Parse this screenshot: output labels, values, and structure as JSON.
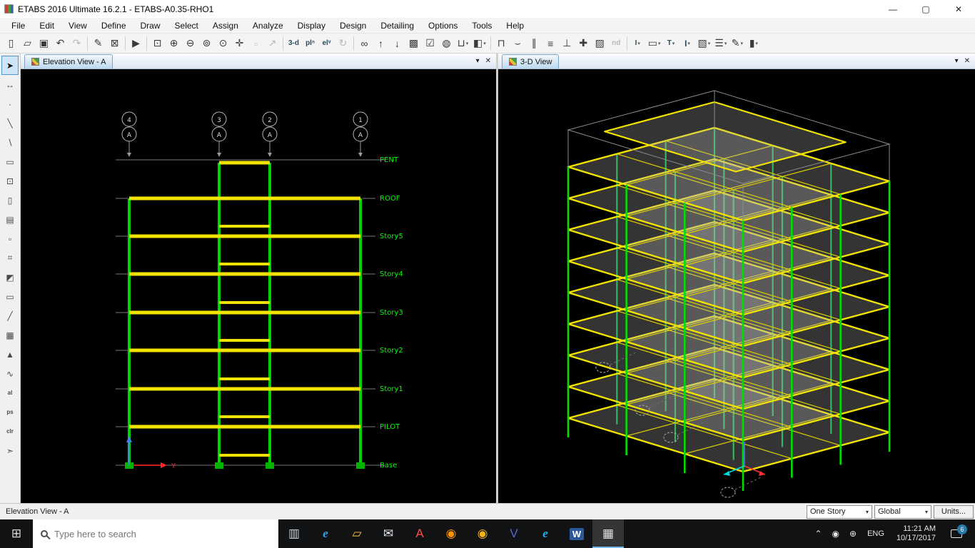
{
  "window": {
    "title": "ETABS 2016 Ultimate 16.2.1 - ETABS-A0.35-RHO1",
    "controls": {
      "minimize": "—",
      "maximize": "▢",
      "close": "✕"
    }
  },
  "menu": {
    "items": [
      "File",
      "Edit",
      "View",
      "Define",
      "Draw",
      "Select",
      "Assign",
      "Analyze",
      "Display",
      "Design",
      "Detailing",
      "Options",
      "Tools",
      "Help"
    ]
  },
  "toolbar": {
    "items": [
      {
        "name": "new-model-icon",
        "glyph": "▯"
      },
      {
        "name": "open-file-icon",
        "glyph": "▱"
      },
      {
        "name": "save-icon",
        "glyph": "▣"
      },
      {
        "name": "undo-icon",
        "glyph": "↶"
      },
      {
        "name": "redo-icon",
        "glyph": "↷",
        "disabled": true
      },
      {
        "sep": true
      },
      {
        "name": "pencil-draw-icon",
        "glyph": "✎"
      },
      {
        "name": "lock-model-icon",
        "glyph": "⊠"
      },
      {
        "sep": true
      },
      {
        "name": "run-analysis-icon",
        "glyph": "▶"
      },
      {
        "sep": true
      },
      {
        "name": "rubber-band-zoom-icon",
        "glyph": "⊡"
      },
      {
        "name": "zoom-in-icon",
        "glyph": "⊕"
      },
      {
        "name": "zoom-out-icon",
        "glyph": "⊖"
      },
      {
        "name": "zoom-full-icon",
        "glyph": "⊚"
      },
      {
        "name": "zoom-previous-icon",
        "glyph": "⊙"
      },
      {
        "name": "pan-icon",
        "glyph": "✛"
      },
      {
        "name": "object-snap-icon",
        "glyph": "▫",
        "disabled": true
      },
      {
        "name": "measure-icon",
        "glyph": "↗",
        "disabled": true
      },
      {
        "sep": true
      },
      {
        "name": "view-3d-button",
        "text": "3-d"
      },
      {
        "name": "view-plan-button",
        "text": "plⁿ"
      },
      {
        "name": "view-elevation-button",
        "text": "elᵛ"
      },
      {
        "name": "rotate-3d-view-icon",
        "glyph": "↻",
        "disabled": true
      },
      {
        "sep": true
      },
      {
        "name": "perspective-toggle-icon",
        "glyph": "∞"
      },
      {
        "name": "move-up-story-icon",
        "glyph": "↑"
      },
      {
        "name": "move-down-story-icon",
        "glyph": "↓"
      },
      {
        "name": "object-shrink-toggle-icon",
        "glyph": "▩"
      },
      {
        "name": "display-options-icon",
        "glyph": "☑"
      },
      {
        "name": "assign-display-icon",
        "glyph": "◍"
      },
      {
        "name": "section-cut-icon",
        "glyph": "⊔",
        "dd": true
      },
      {
        "name": "view-cube-icon",
        "glyph": "◧",
        "dd": true
      },
      {
        "sep": true
      },
      {
        "name": "draw-frame-props-icon",
        "glyph": "⊓"
      },
      {
        "name": "draw-wall-props-icon",
        "glyph": "⌣"
      },
      {
        "name": "frame-output-icon",
        "glyph": "∥"
      },
      {
        "name": "shell-output-icon",
        "glyph": "≡"
      },
      {
        "name": "support-assign-icon",
        "glyph": "⊥"
      },
      {
        "name": "check-model-icon",
        "glyph": "✚"
      },
      {
        "name": "design-combo-icon",
        "glyph": "▨"
      },
      {
        "name": "toolbar-label-nd",
        "text": "nd",
        "disabled": true,
        "flat": true
      },
      {
        "sep": true
      },
      {
        "name": "steel-design-icon",
        "text": "I",
        "dd": true
      },
      {
        "name": "concrete-design-icon",
        "glyph": "▭",
        "dd": true
      },
      {
        "name": "composite-design-icon",
        "text": "T",
        "dd": true
      },
      {
        "name": "section-designer-icon",
        "text": "I",
        "dd": true,
        "bold": true
      },
      {
        "name": "wall-design-icon",
        "glyph": "▧",
        "dd": true
      },
      {
        "name": "detailing-lines-icon",
        "glyph": "☰",
        "dd": true
      },
      {
        "name": "detailing-pen-icon",
        "glyph": "✎",
        "dd": true
      },
      {
        "name": "report-icon",
        "glyph": "▮",
        "dd": true
      }
    ]
  },
  "left_toolbar": {
    "items": [
      {
        "name": "select-pointer-icon",
        "glyph": "➤",
        "active": true
      },
      {
        "name": "reshape-object-icon",
        "glyph": "↔"
      },
      {
        "name": "draw-joint-icon",
        "glyph": "·"
      },
      {
        "name": "draw-frame-icon",
        "glyph": "╲"
      },
      {
        "name": "quick-frame-icon",
        "glyph": "∖"
      },
      {
        "name": "draw-braces-icon",
        "glyph": "▭"
      },
      {
        "name": "quick-braces-icon",
        "glyph": "⊡"
      },
      {
        "name": "draw-floor-icon",
        "glyph": "▯"
      },
      {
        "name": "quick-floor-icon",
        "glyph": "▤"
      },
      {
        "name": "draw-wall-icon",
        "glyph": "▫"
      },
      {
        "name": "quick-wall-icon",
        "glyph": "⌗"
      },
      {
        "name": "draw-window-icon",
        "glyph": "◩"
      },
      {
        "name": "draw-door-icon",
        "glyph": "▭"
      },
      {
        "name": "draw-ref-line-icon",
        "glyph": "╱"
      },
      {
        "name": "draw-grid-icon",
        "glyph": "▦"
      },
      {
        "name": "draw-dimension-icon",
        "glyph": "▲"
      },
      {
        "name": "draw-section-cut-icon",
        "glyph": "∿"
      },
      {
        "name": "select-all-icon",
        "text": "al"
      },
      {
        "name": "previous-selection-icon",
        "text": "ps"
      },
      {
        "name": "clear-selection-icon",
        "text": "clr"
      },
      {
        "name": "select-by-poly-icon",
        "glyph": "➣"
      }
    ]
  },
  "panels": {
    "pane_controls": {
      "menu": "▾",
      "close": "✕"
    },
    "elevation": {
      "tab": "Elevation View - A",
      "stories": [
        "PENT",
        "ROOF",
        "Story5",
        "Story4",
        "Story3",
        "Story2",
        "Story1",
        "PILOT",
        "Base"
      ],
      "grids": [
        "4",
        "3",
        "2",
        "1"
      ],
      "grid_letter": "A",
      "axis_label": "Y"
    },
    "three_d": {
      "tab": "3-D View"
    }
  },
  "statusbar": {
    "text": "Elevation View - A",
    "story_dropdown": "One Story",
    "coord_dropdown": "Global",
    "units_button": "Units..."
  },
  "taskbar": {
    "start_glyph": "⊞",
    "search_placeholder": "Type here to search",
    "apps": [
      {
        "name": "store",
        "glyph": "▥",
        "color": "#cfd8e2"
      },
      {
        "name": "edge",
        "glyph": "e",
        "color": "#35a3e8",
        "style": "italic"
      },
      {
        "name": "file-explorer",
        "glyph": "▱",
        "color": "#f6c445"
      },
      {
        "name": "mail",
        "glyph": "✉",
        "color": "#e8eaed"
      },
      {
        "name": "acrobat",
        "glyph": "A",
        "color": "#ff4b4b"
      },
      {
        "name": "firefox",
        "glyph": "◉",
        "color": "#ff9500"
      },
      {
        "name": "chrome",
        "glyph": "◉",
        "color": "#f1b31c"
      },
      {
        "name": "visio",
        "glyph": "V",
        "color": "#4f6bd8"
      },
      {
        "name": "edge-insider",
        "glyph": "e",
        "color": "#1ab4f0",
        "style": "italic"
      },
      {
        "name": "word",
        "glyph": "W",
        "bg": "#2b579a"
      },
      {
        "name": "etabs",
        "glyph": "▦",
        "color": "#e0e0e0",
        "active": true
      }
    ],
    "tray": [
      {
        "name": "tray-chevron-icon",
        "glyph": "⌃"
      },
      {
        "name": "tray-defender-icon",
        "glyph": "◉"
      },
      {
        "name": "tray-network-icon",
        "glyph": "⊕"
      }
    ],
    "lang": "ENG",
    "time": "11:21 AM",
    "date": "10/17/2017",
    "notification_count": "6"
  }
}
